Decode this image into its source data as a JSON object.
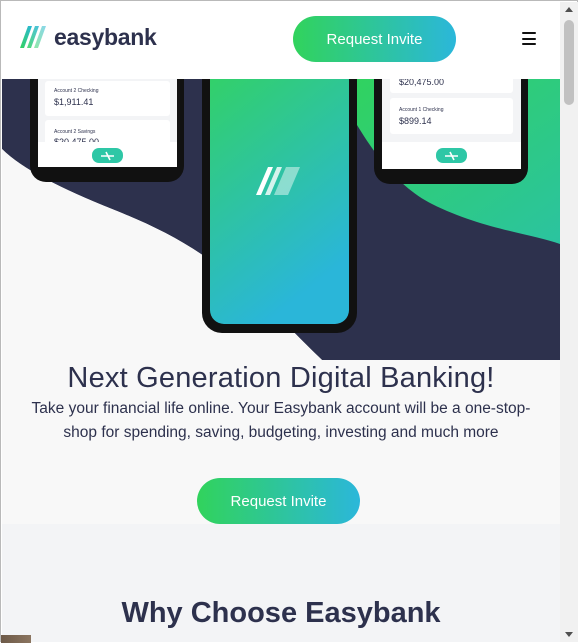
{
  "header": {
    "logo_text": "easybank",
    "logo_icon": "easybank-logo-icon",
    "cta_label": "Request Invite",
    "menu_icon": "hamburger-icon"
  },
  "hero": {
    "phones": {
      "left": {
        "accounts": [
          {
            "name": "Account 2 Checking",
            "balance": "$1,911.41"
          },
          {
            "name": "Account 2 Savings",
            "balance": "$20,475.00"
          }
        ]
      },
      "right": {
        "accounts": [
          {
            "name": "",
            "balance": "$20,475.00"
          },
          {
            "name": "Account 1 Checking",
            "balance": "$899.14"
          }
        ]
      }
    },
    "title": "Next Generation Digital Banking!",
    "description_line1": "Take your financial life online. Your Easybank account will be a one-stop-",
    "description_line2": "shop for spending, saving, budgeting, investing and much more",
    "cta_label": "Request Invite"
  },
  "why": {
    "title": "Why Choose Easybank"
  },
  "colors": {
    "dark_blue": "#2d314d",
    "lime_green": "#31d35c",
    "bright_cyan": "#2bb7da",
    "light_bg": "#f8f8f8"
  }
}
